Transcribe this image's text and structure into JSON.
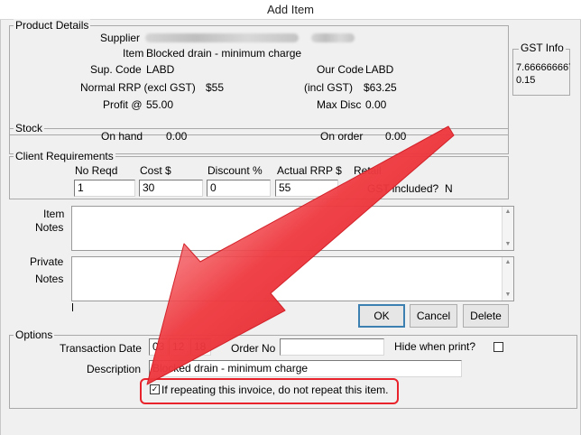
{
  "window": {
    "title": "Add Item"
  },
  "product_details": {
    "legend": "Product Details",
    "supplier_label": "Supplier",
    "item_label": "Item",
    "item_value": "Blocked drain - minimum charge",
    "sup_code_label": "Sup. Code",
    "sup_code_value": "LABD",
    "our_code_label": "Our Code",
    "our_code_value": "LABD",
    "normal_rrp_label": "Normal RRP (excl GST)",
    "normal_rrp_value": "$55",
    "incl_gst_label": "(incl GST)",
    "incl_gst_value": "$63.25",
    "profit_label": "Profit @",
    "profit_value": "55.00",
    "max_disc_label": "Max Disc",
    "max_disc_value": "0.00"
  },
  "gst_info": {
    "legend": "GST Info",
    "value1": "7.666666667",
    "value2": "0.15"
  },
  "stock": {
    "legend": "Stock",
    "on_hand_label": "On hand",
    "on_hand_value": "0.00",
    "on_order_label": "On order",
    "on_order_value": "0.00"
  },
  "client_requirements": {
    "legend": "Client Requirements",
    "no_reqd_label": "No Reqd",
    "no_reqd_value": "1",
    "cost_label": "Cost $",
    "cost_value": "30",
    "discount_label": "Discount %",
    "discount_value": "0",
    "actual_rrp_label": "Actual RRP $",
    "actual_rrp_value": "55",
    "retail_label": "Retail",
    "gst_included_label": "GST included?",
    "gst_included_value": "N"
  },
  "notes": {
    "item_label_1": "Item",
    "item_label_2": "Notes",
    "private_label_1": "Private",
    "private_label_2": "Notes"
  },
  "buttons": {
    "ok": "OK",
    "cancel": "Cancel",
    "delete": "Delete"
  },
  "options": {
    "legend": "Options",
    "transaction_date_label": "Transaction Date",
    "date_day": "03",
    "date_month": "12",
    "date_year": "18",
    "order_no_label": "Order No",
    "order_no_value": "",
    "hide_when_print_label": "Hide when print?",
    "description_label": "Description",
    "description_value": "Blocked drain - minimum charge",
    "no_repeat_label": "If repeating this invoice, do not repeat this item.",
    "no_repeat_checked": true
  },
  "colors": {
    "annotation_red": "#e8232b",
    "dialog_bg": "#f0f0f0"
  }
}
